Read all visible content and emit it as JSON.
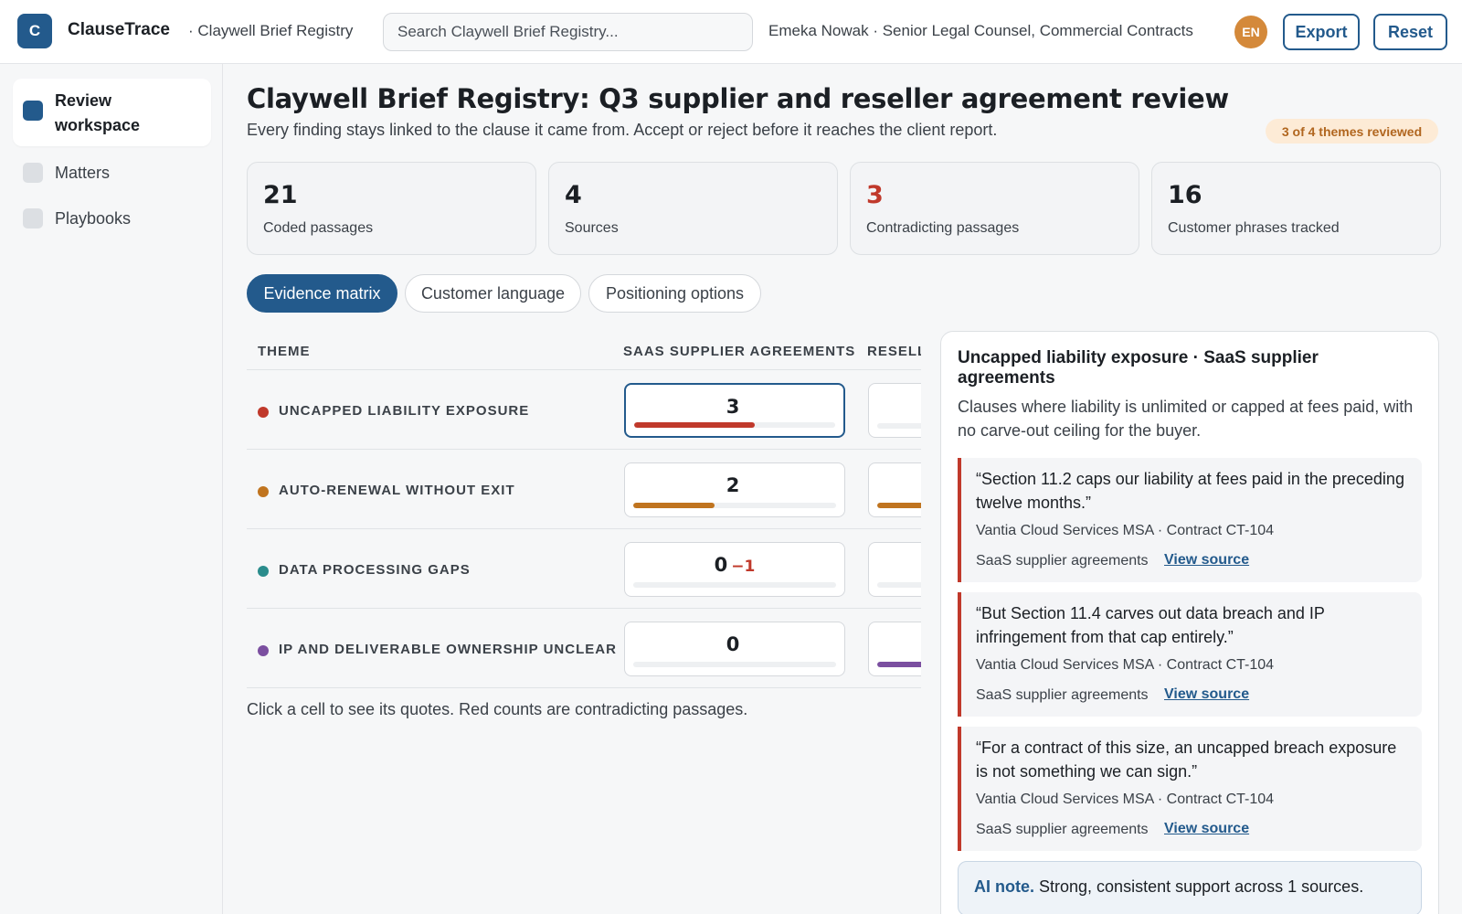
{
  "app": {
    "logo_letter": "C",
    "name": "ClauseTrace",
    "breadcrumb": "· Claywell Brief Registry",
    "search_placeholder": "Search Claywell Brief Registry...",
    "user": "Emeka Nowak · Senior Legal Counsel, Commercial Contracts",
    "avatar_initials": "EN",
    "export_label": "Export",
    "reset_label": "Reset"
  },
  "sidebar": {
    "items": [
      {
        "label": "Review workspace",
        "active": true
      },
      {
        "label": "Matters",
        "active": false
      },
      {
        "label": "Playbooks",
        "active": false
      }
    ]
  },
  "page": {
    "title": "Claywell Brief Registry: Q3 supplier and reseller agreement review",
    "subtitle": "Every finding stays linked to the clause it came from. Accept or reject before it reaches the client report.",
    "progress_badge": "3 of 4 themes reviewed"
  },
  "stats": [
    {
      "value": "21",
      "label": "Coded passages"
    },
    {
      "value": "4",
      "label": "Sources"
    },
    {
      "value": "3",
      "label": "Contradicting passages"
    },
    {
      "value": "16",
      "label": "Customer phrases tracked"
    }
  ],
  "tabs": [
    {
      "label": "Evidence matrix",
      "active": true
    },
    {
      "label": "Customer language",
      "active": false
    },
    {
      "label": "Positioning options",
      "active": false
    }
  ],
  "matrix": {
    "headers": [
      "THEME",
      "SAAS SUPPLIER AGREEMENTS",
      "RESELL"
    ],
    "rows": [
      {
        "theme": "UNCAPPED LIABILITY EXPOSURE",
        "color": "#c0392b",
        "cells": [
          {
            "value": "3",
            "contra": "",
            "fill": 0.6,
            "selected": true
          },
          {
            "value": "",
            "contra": "",
            "fill": 0.0
          }
        ]
      },
      {
        "theme": "AUTO-RENEWAL WITHOUT EXIT",
        "color": "#c0741f",
        "cells": [
          {
            "value": "2",
            "contra": "",
            "fill": 0.4,
            "selected": false
          },
          {
            "value": "",
            "contra": "",
            "fill": 1.0
          }
        ]
      },
      {
        "theme": "DATA PROCESSING GAPS",
        "color": "#2a8c8c",
        "cells": [
          {
            "value": "0",
            "contra": "−1",
            "fill": 0.0,
            "selected": false
          },
          {
            "value": "",
            "contra": "",
            "fill": 0.0
          }
        ]
      },
      {
        "theme": "IP AND DELIVERABLE OWNERSHIP UNCLEAR",
        "color": "#7b4fa0",
        "cells": [
          {
            "value": "0",
            "contra": "",
            "fill": 0.0,
            "selected": false
          },
          {
            "value": "",
            "contra": "",
            "fill": 1.0
          }
        ]
      }
    ],
    "note": "Click a cell to see its quotes. Red counts are contradicting passages."
  },
  "detail": {
    "title": "Uncapped liability exposure · SaaS supplier agreements",
    "description": "Clauses where liability is unlimited or capped at fees paid, with no carve-out ceiling for the buyer.",
    "quotes": [
      {
        "text": "“Section 11.2 caps our liability at fees paid in the preceding twelve months.”",
        "source": "Vantia Cloud Services MSA · Contract CT-104",
        "theme": "SaaS supplier agreements",
        "link": "View source"
      },
      {
        "text": "“But Section 11.4 carves out data breach and IP infringement from that cap entirely.”",
        "source": "Vantia Cloud Services MSA · Contract CT-104",
        "theme": "SaaS supplier agreements",
        "link": "View source"
      },
      {
        "text": "“For a contract of this size, an uncapped breach exposure is not something we can sign.”",
        "source": "Vantia Cloud Services MSA · Contract CT-104",
        "theme": "SaaS supplier agreements",
        "link": "View source"
      }
    ],
    "ai_note_label": "AI note.",
    "ai_note_text": "Strong, consistent support across 1 sources."
  },
  "colors": {
    "accent": "#235a8c",
    "contradiction": "#c0392b",
    "avatar": "#d4893a"
  }
}
